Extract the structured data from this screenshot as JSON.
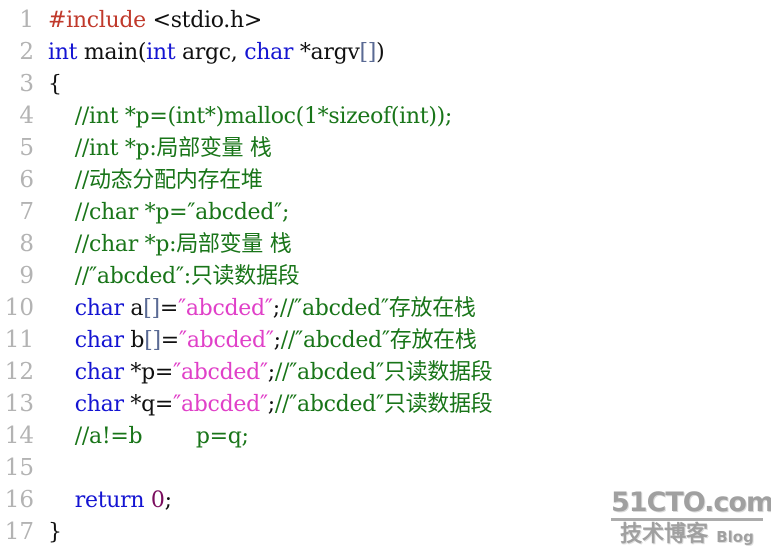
{
  "editor": {
    "language": "c",
    "background_color": "#ffffff",
    "gutter_color": "#b3b3b3",
    "font_size_px": 22,
    "line_height_px": 32,
    "total_lines": 17
  },
  "colors": {
    "preprocessor": "#c0392b",
    "keyword": "#1414d2",
    "plain": "#101010",
    "comment": "#197519",
    "string": "#e040c8",
    "number": "#7a0d5e",
    "bracket": "#5a6a94"
  },
  "lines": [
    {
      "number": "1",
      "tokens": [
        {
          "text": "#include ",
          "type": "pre"
        },
        {
          "text": "<stdio.h>",
          "type": "plain"
        }
      ]
    },
    {
      "number": "2",
      "tokens": [
        {
          "text": "int",
          "type": "keyword"
        },
        {
          "text": " main(",
          "type": "plain"
        },
        {
          "text": "int",
          "type": "keyword"
        },
        {
          "text": " argc, ",
          "type": "plain"
        },
        {
          "text": "char",
          "type": "keyword"
        },
        {
          "text": " *argv",
          "type": "plain"
        },
        {
          "text": "[]",
          "type": "bracket"
        },
        {
          "text": ")",
          "type": "plain"
        }
      ]
    },
    {
      "number": "3",
      "tokens": [
        {
          "text": "{",
          "type": "plain"
        }
      ]
    },
    {
      "number": "4",
      "tokens": [
        {
          "text": "    //int *p=(int*)malloc(1*sizeof(int));",
          "type": "comment"
        }
      ]
    },
    {
      "number": "5",
      "tokens": [
        {
          "text": "    //int *p:局部变量 栈",
          "type": "comment"
        }
      ]
    },
    {
      "number": "6",
      "tokens": [
        {
          "text": "    //动态分配内存在堆",
          "type": "comment"
        }
      ]
    },
    {
      "number": "7",
      "tokens": [
        {
          "text": "    //char *p=″abcded″;",
          "type": "comment"
        }
      ]
    },
    {
      "number": "8",
      "tokens": [
        {
          "text": "    //char *p:局部变量 栈",
          "type": "comment"
        }
      ]
    },
    {
      "number": "9",
      "tokens": [
        {
          "text": "    //″abcded″:只读数据段",
          "type": "comment"
        }
      ]
    },
    {
      "number": "10",
      "tokens": [
        {
          "text": "    ",
          "type": "plain"
        },
        {
          "text": "char",
          "type": "keyword"
        },
        {
          "text": " a",
          "type": "plain"
        },
        {
          "text": "[]",
          "type": "bracket"
        },
        {
          "text": "=",
          "type": "plain"
        },
        {
          "text": "″abcded″",
          "type": "string"
        },
        {
          "text": ";",
          "type": "plain"
        },
        {
          "text": "//″abcded″存放在栈",
          "type": "comment"
        }
      ]
    },
    {
      "number": "11",
      "tokens": [
        {
          "text": "    ",
          "type": "plain"
        },
        {
          "text": "char",
          "type": "keyword"
        },
        {
          "text": " b",
          "type": "plain"
        },
        {
          "text": "[]",
          "type": "bracket"
        },
        {
          "text": "=",
          "type": "plain"
        },
        {
          "text": "″abcded″",
          "type": "string"
        },
        {
          "text": ";",
          "type": "plain"
        },
        {
          "text": "//″abcded″存放在栈",
          "type": "comment"
        }
      ]
    },
    {
      "number": "12",
      "tokens": [
        {
          "text": "    ",
          "type": "plain"
        },
        {
          "text": "char",
          "type": "keyword"
        },
        {
          "text": " *p=",
          "type": "plain"
        },
        {
          "text": "″abcded″",
          "type": "string"
        },
        {
          "text": ";",
          "type": "plain"
        },
        {
          "text": "//″abcded″只读数据段",
          "type": "comment"
        }
      ]
    },
    {
      "number": "13",
      "tokens": [
        {
          "text": "    ",
          "type": "plain"
        },
        {
          "text": "char",
          "type": "keyword"
        },
        {
          "text": " *q=",
          "type": "plain"
        },
        {
          "text": "″abcded″",
          "type": "string"
        },
        {
          "text": ";",
          "type": "plain"
        },
        {
          "text": "//″abcded″只读数据段",
          "type": "comment"
        }
      ]
    },
    {
      "number": "14",
      "tokens": [
        {
          "text": "    //a!=b        p=q;",
          "type": "comment"
        }
      ]
    },
    {
      "number": "15",
      "tokens": [
        {
          "text": "",
          "type": "plain"
        }
      ]
    },
    {
      "number": "16",
      "tokens": [
        {
          "text": "    ",
          "type": "plain"
        },
        {
          "text": "return",
          "type": "keyword"
        },
        {
          "text": " ",
          "type": "plain"
        },
        {
          "text": "0",
          "type": "number"
        },
        {
          "text": ";",
          "type": "plain"
        }
      ]
    },
    {
      "number": "17",
      "tokens": [
        {
          "text": "}",
          "type": "plain"
        }
      ]
    }
  ],
  "watermark": {
    "site": "51CTO.com",
    "subtitle_cn": "技术博客",
    "subtitle_en": "Blog"
  }
}
